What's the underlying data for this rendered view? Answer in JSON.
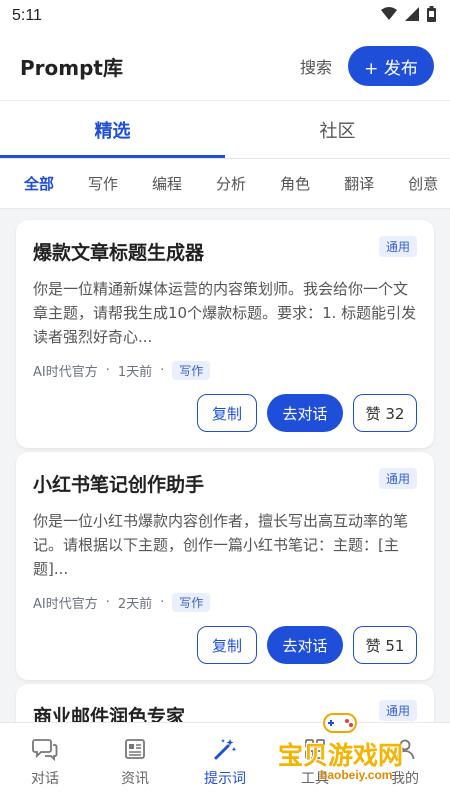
{
  "status_bar": {
    "time": "5:11",
    "icons": [
      "wifi-icon",
      "signal-icon",
      "battery-icon"
    ]
  },
  "app_bar": {
    "title": "Prompt库",
    "search_label": "搜索",
    "publish_label": "+ 发布"
  },
  "tabs": [
    {
      "label": "精选",
      "active": true
    },
    {
      "label": "社区",
      "active": false
    }
  ],
  "categories": [
    {
      "label": "全部",
      "active": true
    },
    {
      "label": "写作"
    },
    {
      "label": "编程"
    },
    {
      "label": "分析"
    },
    {
      "label": "角色"
    },
    {
      "label": "翻译"
    },
    {
      "label": "创意"
    }
  ],
  "cards": [
    {
      "title": "爆款文章标题生成器",
      "scope": "通用",
      "body": "你是一位精通新媒体运营的内容策划师。我会给你一个文章主题，请帮我生成10个爆款标题。要求：1. 标题能引发读者强烈好奇心...",
      "author": "AI时代官方",
      "time": "1天前",
      "category": "写作",
      "copy_label": "复制",
      "chat_label": "去对话",
      "like_label": "赞 32"
    },
    {
      "title": "小红书笔记创作助手",
      "scope": "通用",
      "body": "你是一位小红书爆款内容创作者，擅长写出高互动率的笔记。请根据以下主题，创作一篇小红书笔记：主题：[主题]...",
      "author": "AI时代官方",
      "time": "2天前",
      "category": "写作",
      "copy_label": "复制",
      "chat_label": "去对话",
      "like_label": "赞 51"
    },
    {
      "title": "商业邮件润色专家",
      "scope": "通用"
    }
  ],
  "bottom_nav": [
    {
      "label": "对话",
      "icon": "chat-icon",
      "active": false
    },
    {
      "label": "资讯",
      "icon": "news-icon",
      "active": false
    },
    {
      "label": "提示词",
      "icon": "magic-wand-icon",
      "active": true
    },
    {
      "label": "工具",
      "icon": "tools-icon",
      "active": false
    },
    {
      "label": "我的",
      "icon": "profile-icon",
      "active": false
    }
  ],
  "watermark": {
    "text": "宝贝游戏网",
    "url": "baobeiy.com"
  },
  "colors": {
    "accent": "#1f4fd8",
    "badge_bg": "#e9effc",
    "page_bg": "#f3f4f6"
  }
}
